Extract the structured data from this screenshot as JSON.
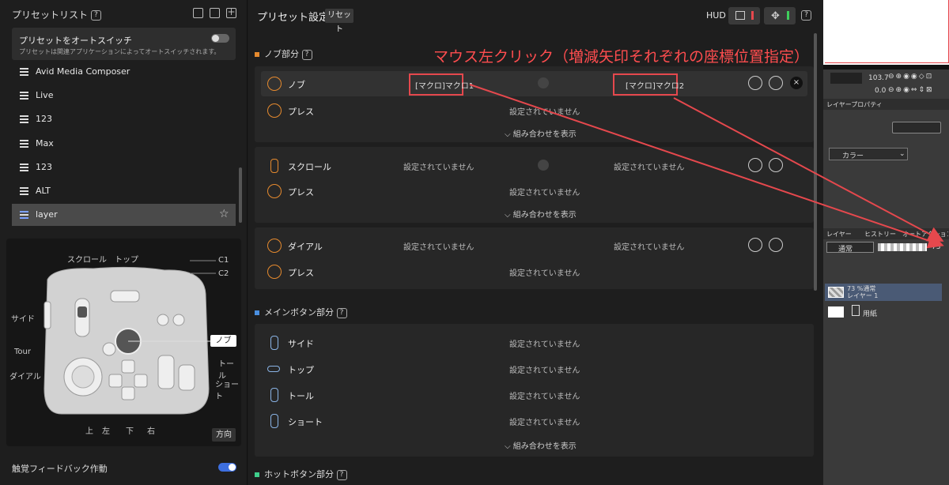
{
  "left": {
    "preset_list_title": "プリセットリスト",
    "help": "?",
    "auto_switch": {
      "title": "プリセットをオートスイッチ",
      "desc": "プリセットは関連アプリケーションによってオートスイッチされます。"
    },
    "presets": [
      "Avid Media Composer",
      "Live",
      "123",
      "Max",
      "123",
      "ALT",
      "layer"
    ],
    "selected_preset": "layer",
    "device_labels": {
      "scroll": "スクロール",
      "top": "トップ",
      "c1": "C1",
      "c2": "C2",
      "side": "サイド",
      "tour": "Tour",
      "dial": "ダイアル",
      "knob": "ノブ",
      "toll": "トール",
      "short": "ショート",
      "up": "上",
      "left": "左",
      "down": "下",
      "right": "右"
    },
    "direction_button": "方向",
    "haptic": "触覚フィードバック作動"
  },
  "main": {
    "title": "プリセット設定",
    "reset": "リセット",
    "hud": "HUD",
    "annotation": "マウス左クリック（増減矢印それぞれの座標位置指定）",
    "knob_section": {
      "title": "ノブ部分",
      "cards": [
        {
          "rows": [
            {
              "label": "ノブ",
              "left": "[マクロ]マクロ1",
              "right": "[マクロ]マクロ2"
            },
            {
              "label": "プレス",
              "value": "設定されていません"
            }
          ],
          "expand": "組み合わせを表示"
        },
        {
          "rows": [
            {
              "label": "スクロール",
              "left": "設定されていません",
              "right": "設定されていません"
            },
            {
              "label": "プレス",
              "value": "設定されていません"
            }
          ],
          "expand": "組み合わせを表示"
        },
        {
          "rows": [
            {
              "label": "ダイアル",
              "left": "設定されていません",
              "right": "設定されていません"
            },
            {
              "label": "プレス",
              "value": "設定されていません"
            }
          ]
        }
      ]
    },
    "main_buttons": {
      "title": "メインボタン部分",
      "rows": [
        {
          "label": "サイド",
          "value": "設定されていません"
        },
        {
          "label": "トップ",
          "value": "設定されていません"
        },
        {
          "label": "トール",
          "value": "設定されていません"
        },
        {
          "label": "ショート",
          "value": "設定されていません"
        }
      ],
      "expand": "組み合わせを表示"
    },
    "hot_buttons_title": "ホットボタン部分"
  },
  "right": {
    "zoom": "103.7",
    "rot": "0.0",
    "tab_layer_prop": "レイヤープロパティ",
    "color_label": "カラー",
    "tab_layer": "レイヤー",
    "tab_history": "ヒストリー",
    "tab_auto": "オートアクション",
    "blend_mode": "通常",
    "opacity": "73",
    "layer1_line1": "73 %通常",
    "layer1_line2": "レイヤー 1",
    "paper": "用紙"
  },
  "colors": {
    "accent_orange": "#e68a2e",
    "accent_blue": "#3d6fe0",
    "annotation_red": "#ff4d4f"
  }
}
